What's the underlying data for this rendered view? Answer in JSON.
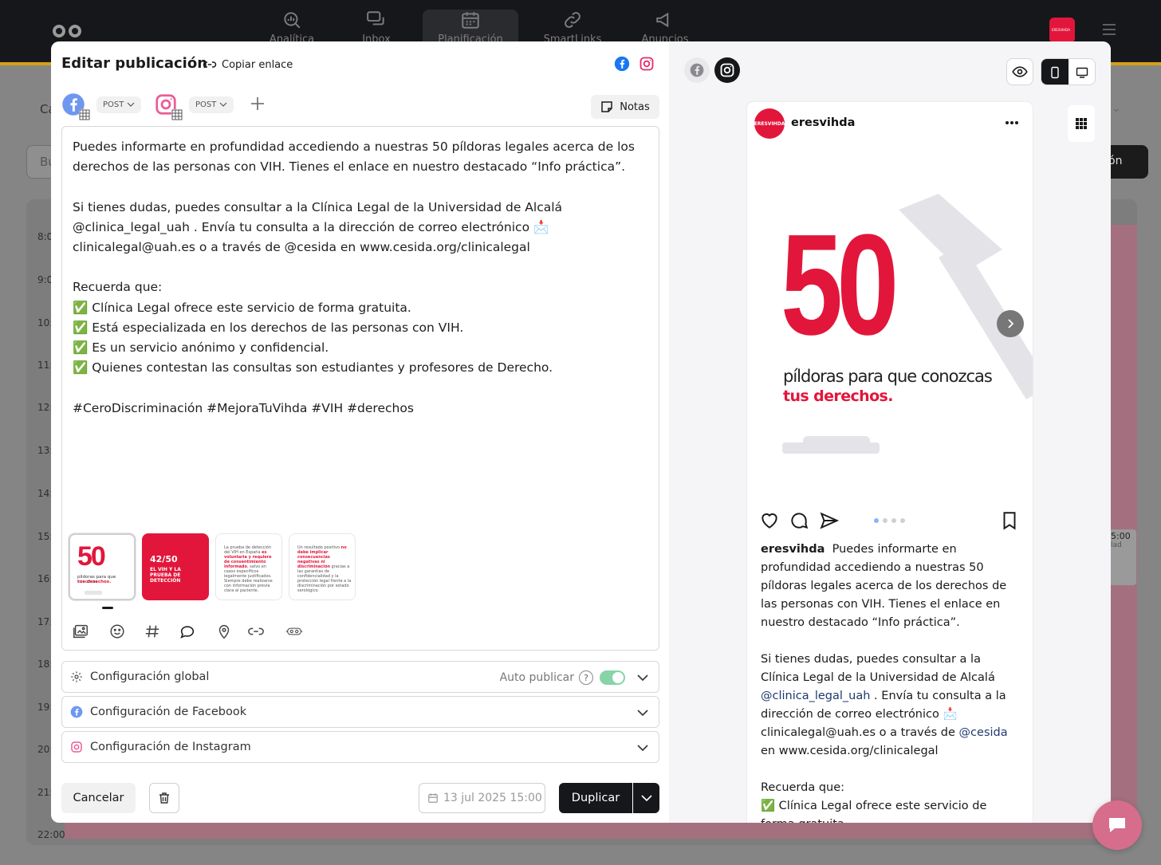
{
  "app": {
    "nav": [
      {
        "label": "Analítica",
        "icon": "analytics-icon"
      },
      {
        "label": "Inbox",
        "icon": "inbox-icon"
      },
      {
        "label": "Planificación",
        "icon": "calendar-icon"
      },
      {
        "label": "SmartLinks",
        "icon": "link-icon"
      },
      {
        "label": "Anuncios",
        "icon": "megaphone-icon"
      }
    ],
    "account_avatar_text": "ERESVIHDA",
    "bg_tab": "Ca",
    "bg_search": "Bu",
    "bg_button": "ón",
    "calendar_hours": [
      "8:0",
      "9:0",
      "10:0",
      "11:0",
      "12:0",
      "13:0",
      "14:0",
      "15:0",
      "16:0",
      "17:0",
      "18:0",
      "19:0",
      "20:0",
      "21:0",
      "22:00"
    ],
    "bg_event_time": "5:00",
    "bg_event_text": "lad"
  },
  "editor": {
    "title": "Editar publicación",
    "copy_link": "Copiar enlace",
    "networks": [
      {
        "name": "facebook",
        "type": "POST"
      },
      {
        "name": "instagram",
        "type": "POST"
      }
    ],
    "notes_label": "Notas",
    "caption": "Puedes informarte en profundidad accediendo a nuestras 50 píldoras legales acerca de los derechos de las personas con VIH. Tienes el enlace en nuestro destacado “Info práctica”.\n\nSi tienes dudas, puedes consultar a la Clínica Legal de la Universidad de Alcalá @clinica_legal_uah . Envía tu consulta a la dirección de correo electrónico 📩 clinicalegal@uah.es o a través de @cesida en www.cesida.org/clinicalegal\n\nRecuerda que:\n✅ Clínica Legal ofrece este servicio de forma gratuita.\n✅ Está especializada en los derechos de las personas con VIH.\n✅ Es un servicio anónimo y confidencial.\n✅ Quienes contestan las consultas son estudiantes y profesores de Derecho.\n\n#CeroDiscriminación #MejoraTuVihda #VIH #derechos",
    "thumbnails": {
      "t1_big": "50",
      "t1_line1": "píldoras para que conozcas",
      "t1_line2": "tus derechos.",
      "t2_num": "42/50",
      "t2_text": "EL VIH Y LA PRUEBA DE DETECCIÓN",
      "t3_a": "La prueba de detección del VIH en España ",
      "t3_b": "es voluntaria y requiere de consentimiento informado",
      "t3_c": ", salvo en casos específicos legalmente justificados. Siempre debe realizarse con información previa clara al paciente.",
      "t4_a": "Un resultado positivo ",
      "t4_b": "no debe implicar consecuencias negativas ni discriminación",
      "t4_c": " gracias a las garantías de confidencialidad y la protección legal frente a la discriminación por estado serológico."
    },
    "sections": {
      "global": "Configuración global",
      "auto_publish": "Auto publicar",
      "facebook": "Configuración de Facebook",
      "instagram": "Configuración de Instagram"
    },
    "footer": {
      "cancel": "Cancelar",
      "date": "13 jul 2025 15:00",
      "duplicate": "Duplicar"
    }
  },
  "preview": {
    "avatar_text": "ERESVIHDA",
    "username": "eresvihda",
    "image_number": "50",
    "image_line1": "píldoras para que conozcas",
    "image_line2": "tus derechos.",
    "caption_lead": "Puedes informarte en profundidad accediendo a nuestras 50 píldoras legales acerca de los derechos de las personas con VIH. Tienes el enlace en nuestro destacado “Info práctica”.\n\nSi tienes dudas, puedes consultar a la Clínica Legal de la Universidad de Alcalá ",
    "mention1": "@clinica_legal_uah",
    "caption_mid": " . Envía tu consulta a la dirección de correo electrónico 📩 clinicalegal@uah.es o a través de ",
    "mention2": "@cesida",
    "caption_tail": " en www.cesida.org/clinicalegal\n\nRecuerda que:\n✅ Clínica Legal ofrece este servicio de forma gratuita."
  },
  "colors": {
    "brand_red": "#e2163b",
    "facebook_blue": "#1877f2",
    "instagram_pink": "#e1306c",
    "toggle_on": "#86d4a8",
    "dark_button": "#16171a"
  }
}
